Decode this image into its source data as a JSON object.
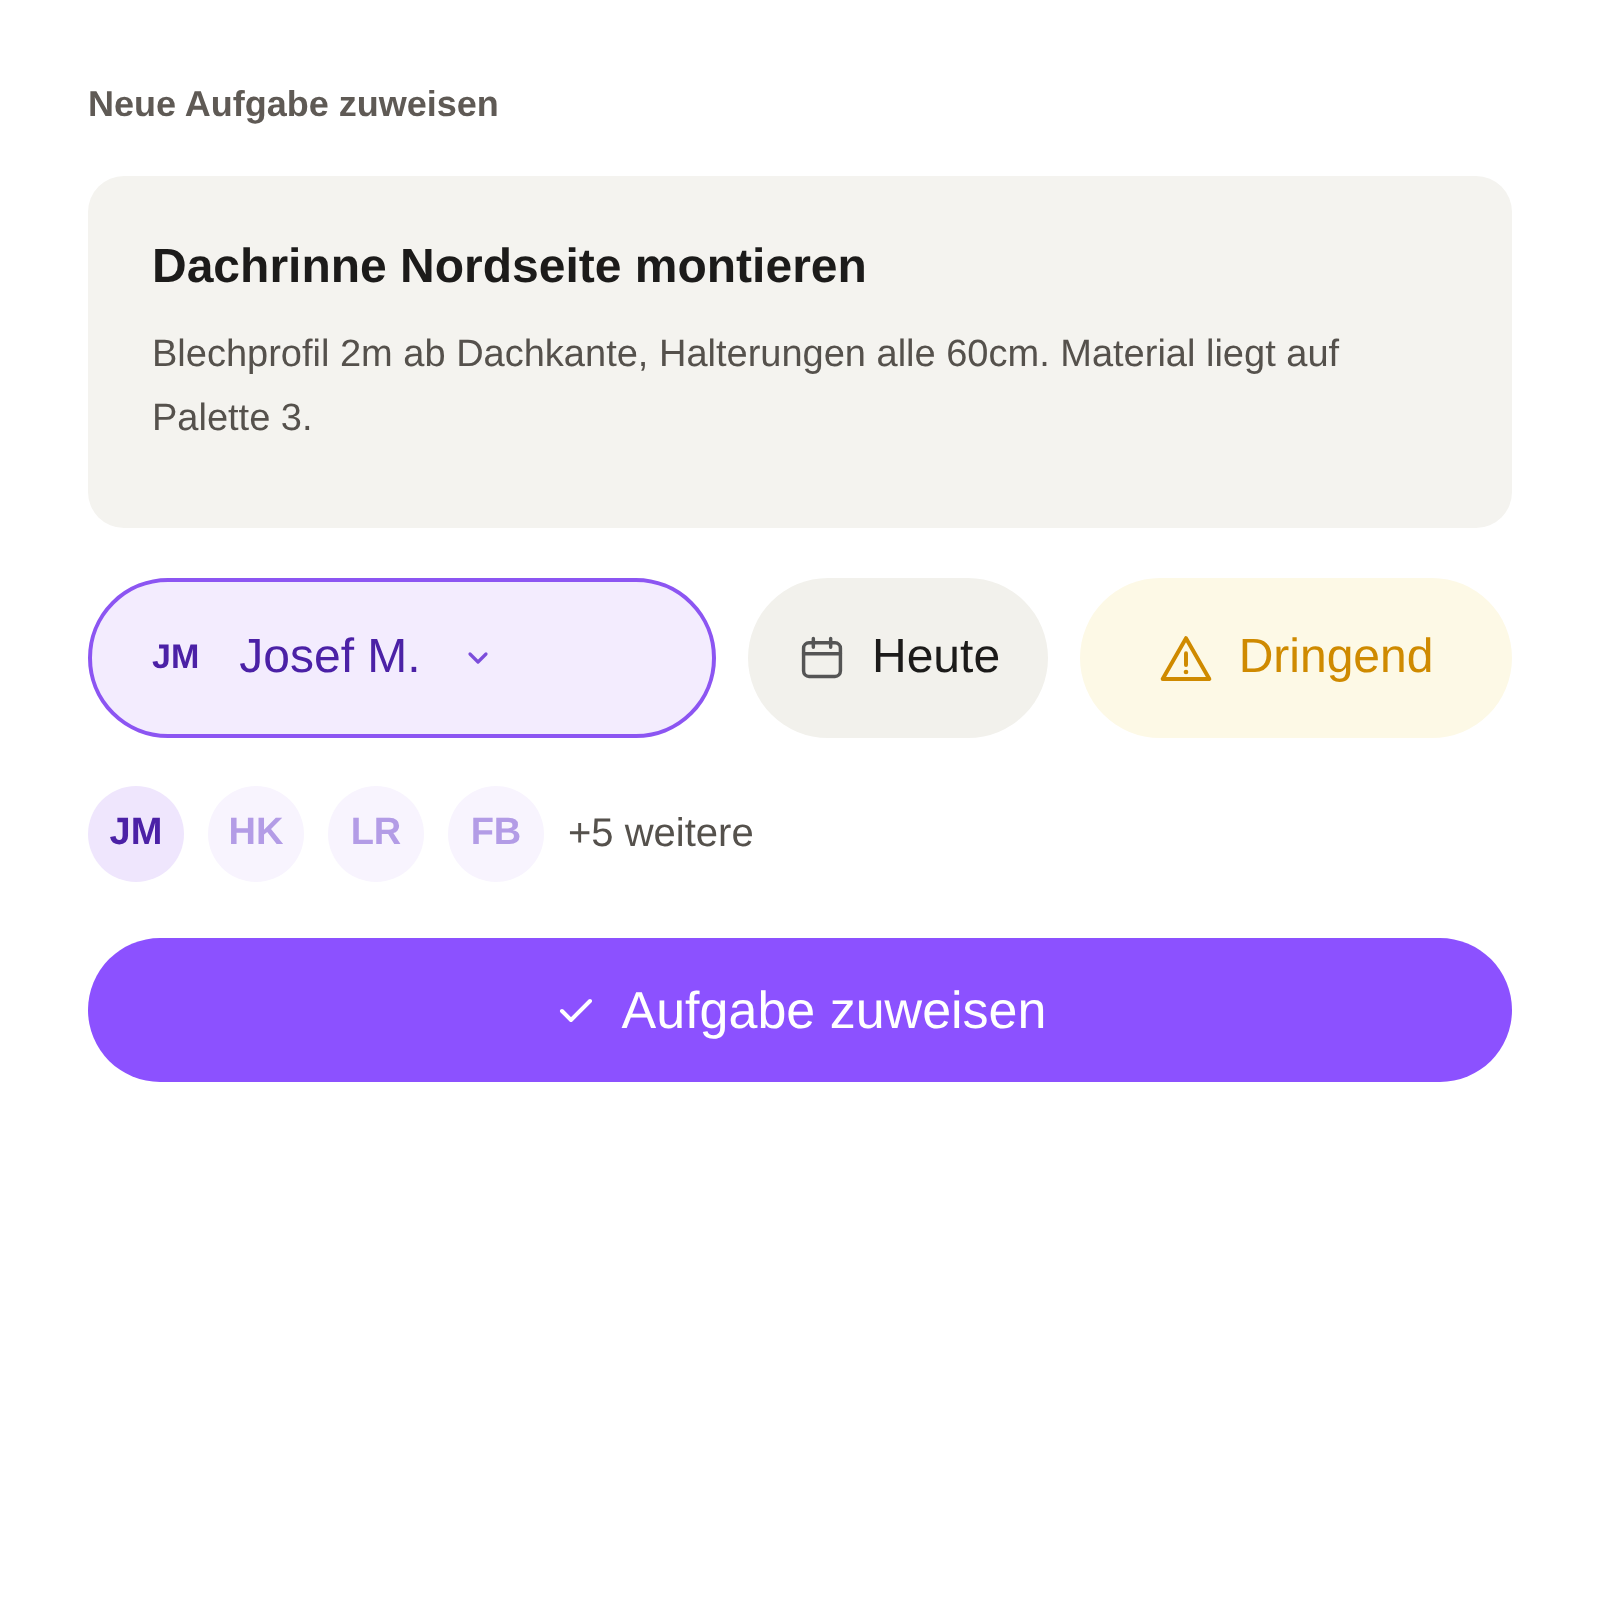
{
  "heading": "Neue Aufgabe zuweisen",
  "task": {
    "title": "Dachrinne Nordseite montieren",
    "description": "Blechprofil 2m ab Dachkante, Halterungen alle 60cm. Material liegt auf Palette 3."
  },
  "chips": [
    {
      "kind": "assignee",
      "initials": "JM",
      "label": "Josef M."
    },
    {
      "kind": "date",
      "label": "Heute"
    },
    {
      "kind": "priority",
      "label": "Dringend"
    }
  ],
  "avatars": [
    {
      "initials": "JM",
      "selected": true
    },
    {
      "initials": "HK",
      "selected": false
    },
    {
      "initials": "LR",
      "selected": false
    },
    {
      "initials": "FB",
      "selected": false
    }
  ],
  "more": "+5 weitere",
  "submit": "Aufgabe zuweisen"
}
